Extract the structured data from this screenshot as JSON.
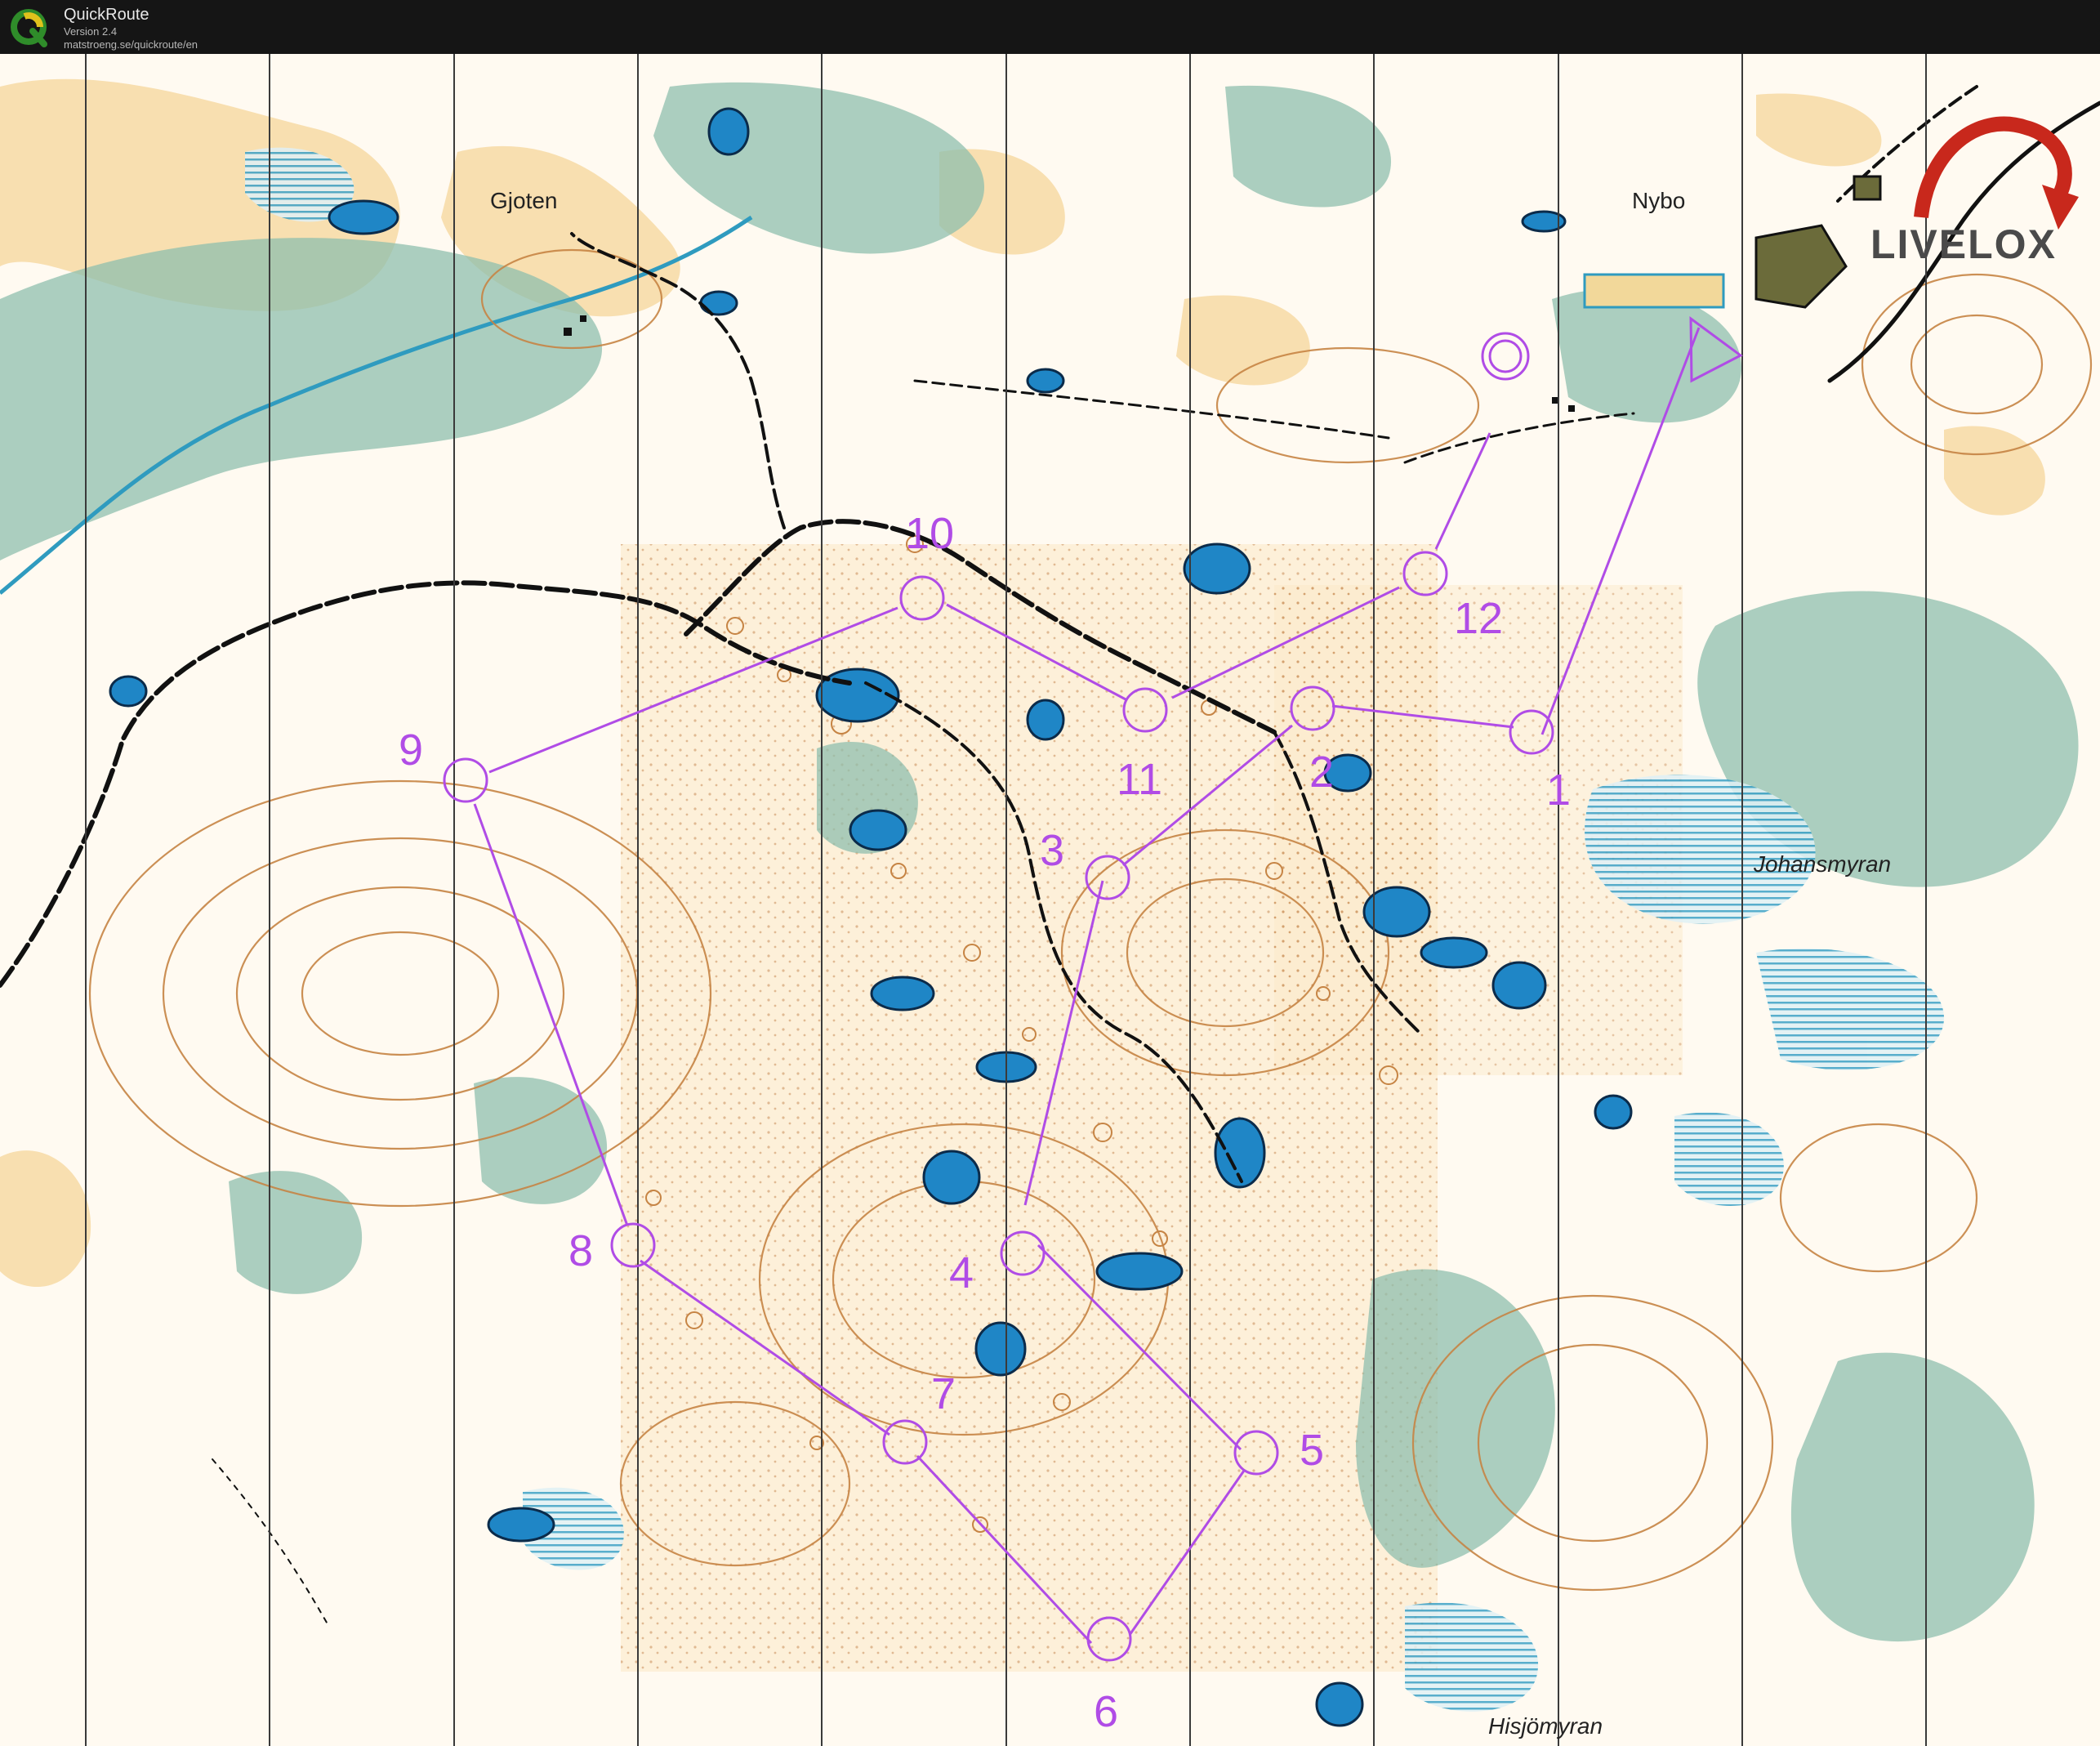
{
  "app": {
    "title": "QuickRoute",
    "version": "Version 2.4",
    "url": "matstroeng.se/quickroute/en"
  },
  "map": {
    "place_names": [
      "Gjoten",
      "Nybo",
      "Johansmyran",
      "Hisjömyran"
    ],
    "brand_logo_text": "LIVELOX",
    "course": {
      "start_symbol": "start-triangle",
      "finish_symbol": "finish-double-circle",
      "controls": [
        {
          "number": "1"
        },
        {
          "number": "2"
        },
        {
          "number": "3"
        },
        {
          "number": "4"
        },
        {
          "number": "5"
        },
        {
          "number": "6"
        },
        {
          "number": "7"
        },
        {
          "number": "8"
        },
        {
          "number": "9"
        },
        {
          "number": "10"
        },
        {
          "number": "11"
        },
        {
          "number": "12"
        }
      ]
    },
    "colors": {
      "course": "#b04ce6",
      "water": "#1f86c6",
      "marsh": "#2f9bbf",
      "vegetation_green": "#8fbfae",
      "open_land": "#f7d9a4",
      "contour": "#c68444",
      "track": "#111111",
      "titlebar": "#151515"
    }
  }
}
